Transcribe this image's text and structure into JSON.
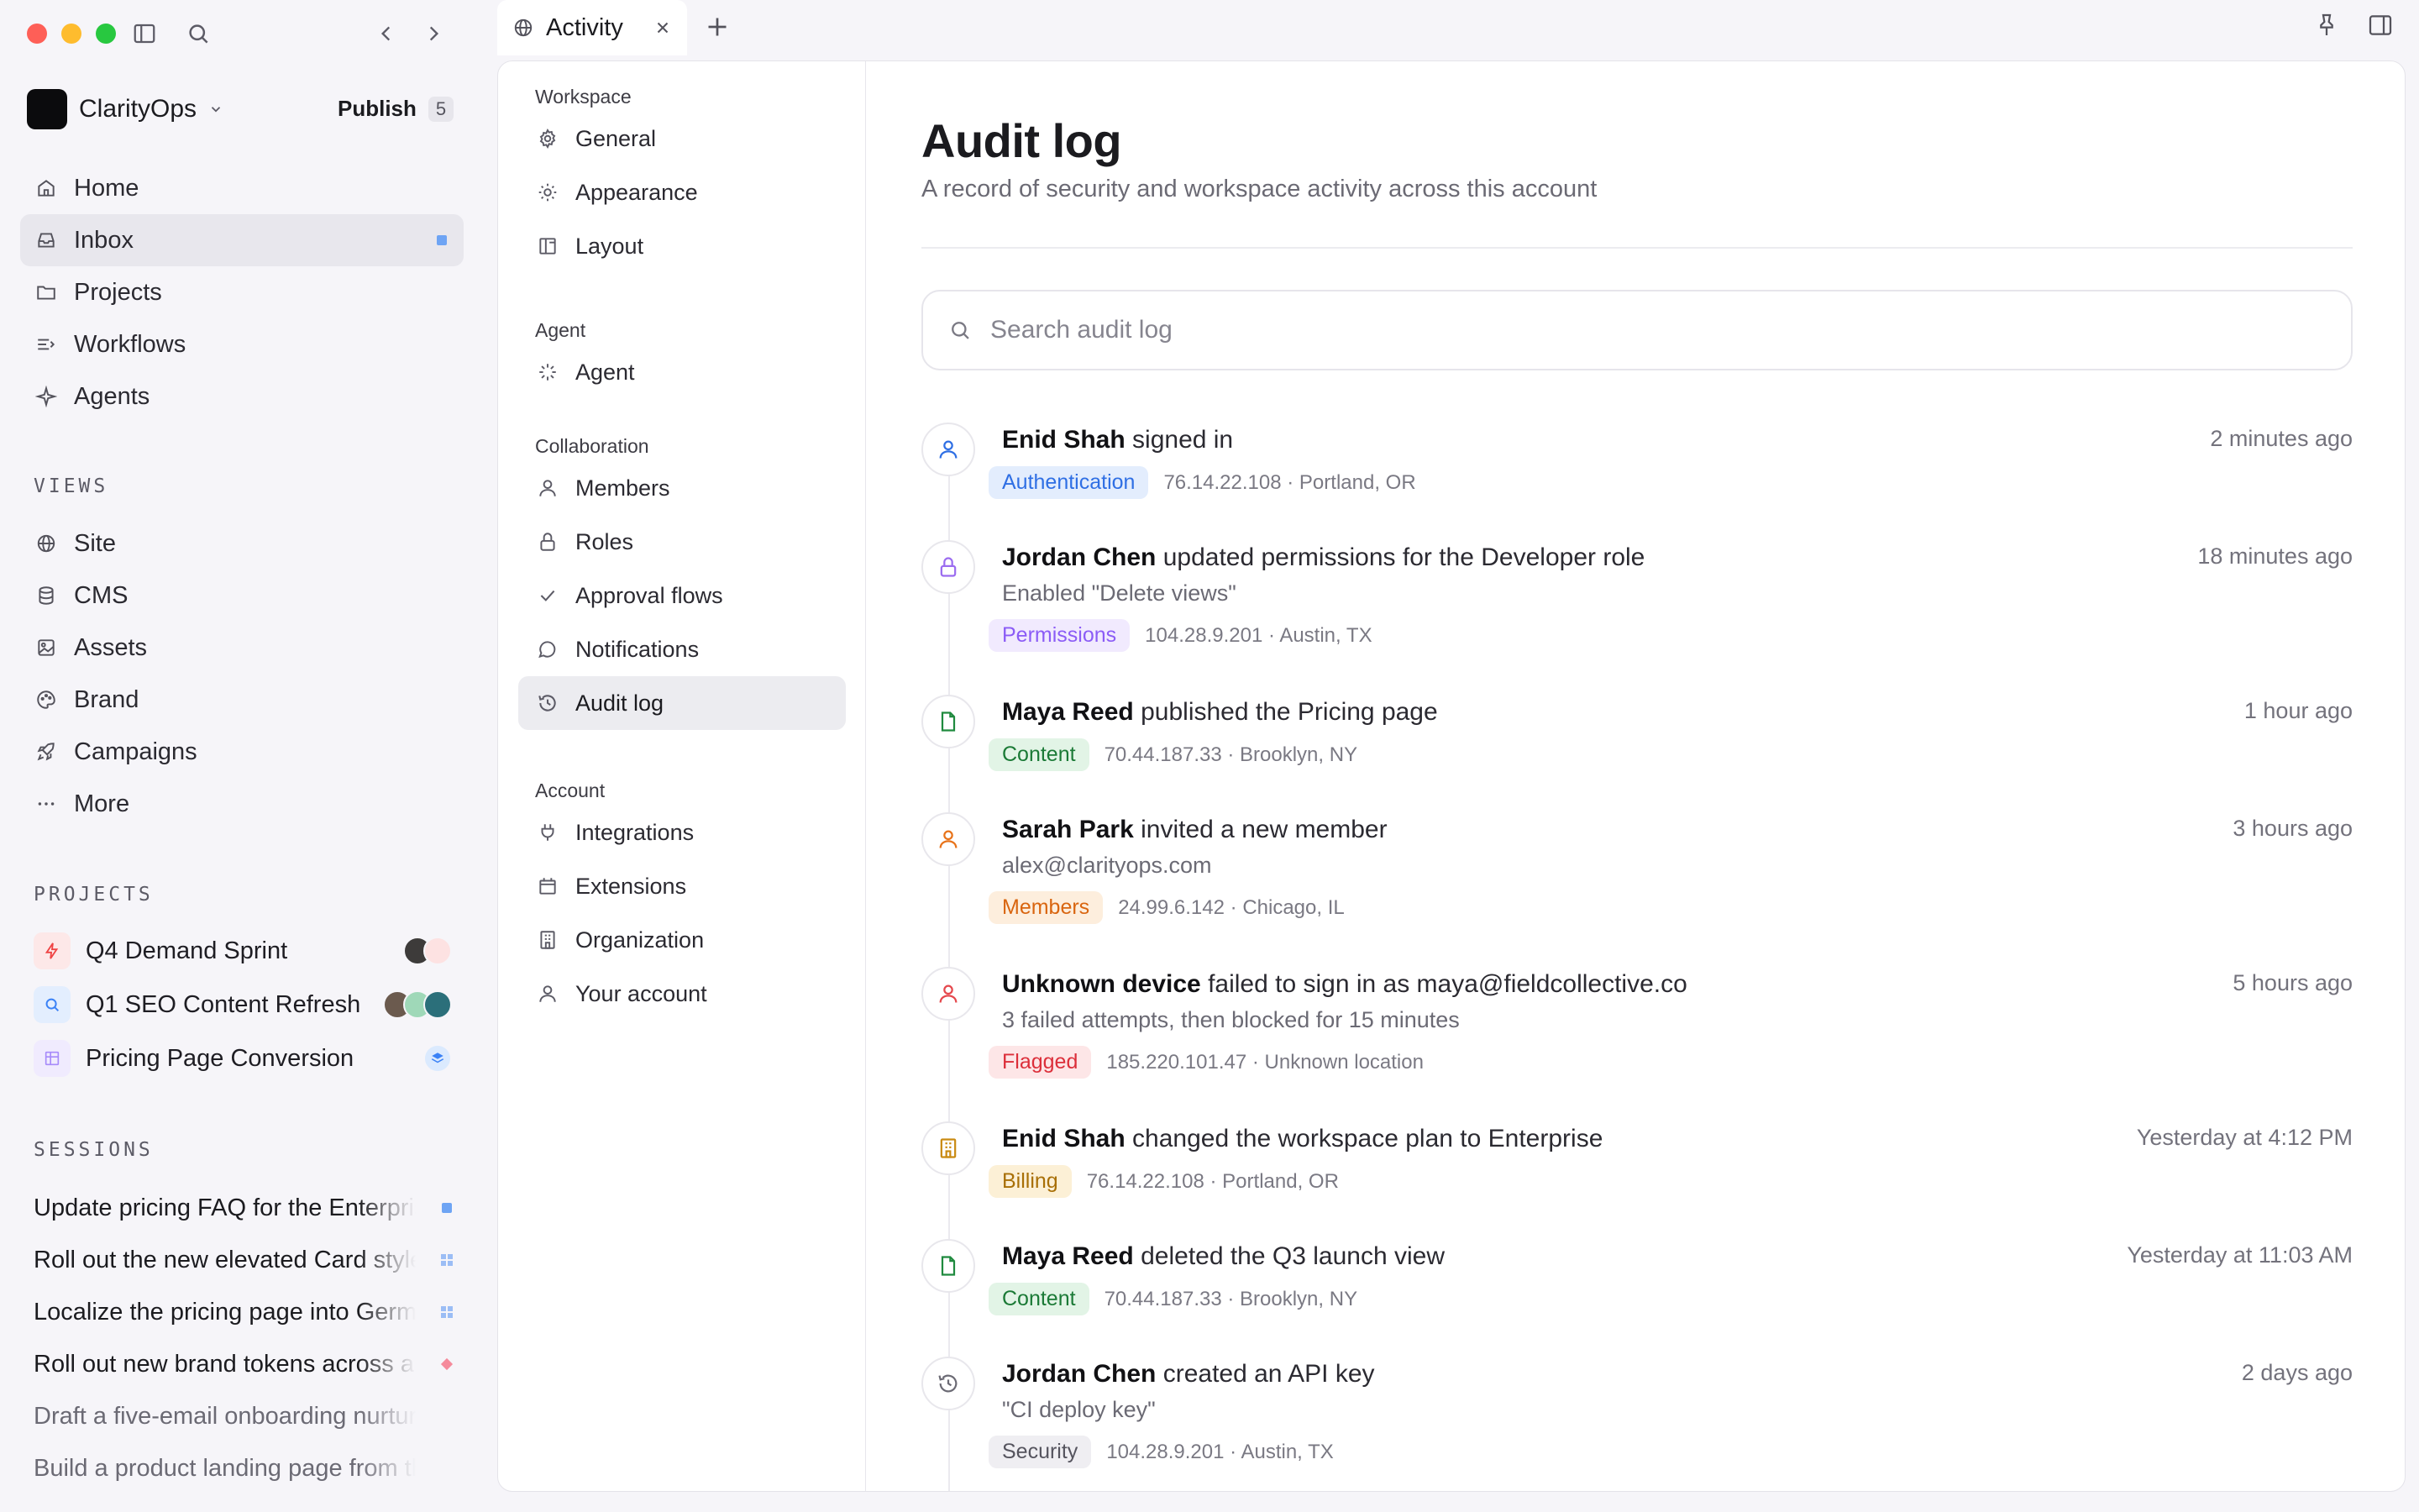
{
  "window": {
    "tab": {
      "label": "Activity"
    }
  },
  "sidebar": {
    "workspace": {
      "name": "ClarityOps",
      "publish_label": "Publish",
      "publish_count": "5"
    },
    "primary": [
      {
        "label": "Home",
        "icon": "home-icon"
      },
      {
        "label": "Inbox",
        "icon": "inbox-icon",
        "active": true
      },
      {
        "label": "Projects",
        "icon": "folder-icon"
      },
      {
        "label": "Workflows",
        "icon": "workflows-icon"
      },
      {
        "label": "Agents",
        "icon": "sparkle-icon"
      }
    ],
    "views_label": "VIEWS",
    "views": [
      {
        "label": "Site",
        "icon": "globe-icon"
      },
      {
        "label": "CMS",
        "icon": "database-icon"
      },
      {
        "label": "Assets",
        "icon": "image-icon"
      },
      {
        "label": "Brand",
        "icon": "palette-icon"
      },
      {
        "label": "Campaigns",
        "icon": "rocket-icon"
      },
      {
        "label": "More",
        "icon": "more-icon"
      }
    ],
    "projects_label": "PROJECTS",
    "projects": [
      {
        "label": "Q4 Demand Sprint",
        "icon": "bolt-icon",
        "color": "#ef4444",
        "bg": "#fde8e8"
      },
      {
        "label": "Q1 SEO Content Refresh",
        "icon": "search-icon",
        "color": "#3b82f6",
        "bg": "#e3eefe"
      },
      {
        "label": "Pricing Page Conversion",
        "icon": "grid-icon",
        "color": "#a78bfa",
        "bg": "#f0ebfe"
      }
    ],
    "sessions_label": "SESSIONS",
    "sessions": [
      {
        "label": "Update pricing FAQ for the Enterprise tier",
        "mark": "blue-square"
      },
      {
        "label": "Roll out the new elevated Card style",
        "mark": "blue-grid"
      },
      {
        "label": "Localize the pricing page into German",
        "mark": "blue-grid"
      },
      {
        "label": "Roll out new brand tokens across all pages",
        "mark": "pink-diamond"
      },
      {
        "label": "Draft a five-email onboarding nurture sequence",
        "mark": "none",
        "muted": true
      },
      {
        "label": "Build a product landing page from the brief",
        "mark": "none",
        "muted": true
      }
    ]
  },
  "settings_nav": [
    {
      "title": "Workspace",
      "items": [
        {
          "label": "General",
          "icon": "gear-icon"
        },
        {
          "label": "Appearance",
          "icon": "sun-icon"
        },
        {
          "label": "Layout",
          "icon": "layout-icon"
        }
      ]
    },
    {
      "title": "Agent",
      "items": [
        {
          "label": "Agent",
          "icon": "loader-icon"
        }
      ]
    },
    {
      "title": "Collaboration",
      "items": [
        {
          "label": "Members",
          "icon": "user-icon"
        },
        {
          "label": "Roles",
          "icon": "lock-icon"
        },
        {
          "label": "Approval flows",
          "icon": "check-icon"
        },
        {
          "label": "Notifications",
          "icon": "chat-icon"
        },
        {
          "label": "Audit log",
          "icon": "history-icon",
          "active": true
        }
      ]
    },
    {
      "title": "Account",
      "items": [
        {
          "label": "Integrations",
          "icon": "plug-icon"
        },
        {
          "label": "Extensions",
          "icon": "calendar-icon"
        },
        {
          "label": "Organization",
          "icon": "building-icon"
        },
        {
          "label": "Your account",
          "icon": "user-icon"
        }
      ]
    }
  ],
  "main": {
    "title": "Audit log",
    "subtitle": "A record of security and workspace activity across this account",
    "search_placeholder": "Search audit log",
    "entries": [
      {
        "actor": "Enid Shah",
        "action": "signed in",
        "detail": "",
        "category": "Authentication",
        "ip": "76.14.22.108",
        "location": "Portland, OR",
        "time": "2 minutes ago",
        "icon": "user-icon",
        "color": "#2f6fe4",
        "badge_bg": "#e3edfd",
        "badge_fg": "#2f6fe4"
      },
      {
        "actor": "Jordan Chen",
        "action": "updated permissions for the Developer role",
        "detail": "Enabled \"Delete views\"",
        "category": "Permissions",
        "ip": "104.28.9.201",
        "location": "Austin, TX",
        "time": "18 minutes ago",
        "icon": "lock-icon",
        "color": "#9b6cf0",
        "badge_bg": "#f1eafe",
        "badge_fg": "#8b5cf6"
      },
      {
        "actor": "Maya Reed",
        "action": "published the Pricing page",
        "detail": "",
        "category": "Content",
        "ip": "70.44.187.33",
        "location": "Brooklyn, NY",
        "time": "1 hour ago",
        "icon": "file-icon",
        "color": "#1f8a3e",
        "badge_bg": "#e2f4e6",
        "badge_fg": "#1b7a36"
      },
      {
        "actor": "Sarah Park",
        "action": "invited a new member",
        "detail": "alex@clarityops.com",
        "category": "Members",
        "ip": "24.99.6.142",
        "location": "Chicago, IL",
        "time": "3 hours ago",
        "icon": "user-icon",
        "color": "#e8731a",
        "badge_bg": "#fdeedd",
        "badge_fg": "#d9650f"
      },
      {
        "actor": "Unknown device",
        "action": "failed to sign in as maya@fieldcollective.co",
        "detail": "3 failed attempts, then blocked for 15 minutes",
        "category": "Flagged",
        "ip": "185.220.101.47",
        "location": "Unknown location",
        "time": "5 hours ago",
        "icon": "user-icon",
        "color": "#e5484d",
        "badge_bg": "#fde6e7",
        "badge_fg": "#dc2f3a"
      },
      {
        "actor": "Enid Shah",
        "action": "changed the workspace plan to Enterprise",
        "detail": "",
        "category": "Billing",
        "ip": "76.14.22.108",
        "location": "Portland, OR",
        "time": "Yesterday at 4:12 PM",
        "icon": "building-icon",
        "color": "#c98a12",
        "badge_bg": "#fcf0d6",
        "badge_fg": "#a86f06"
      },
      {
        "actor": "Maya Reed",
        "action": "deleted the Q3 launch view",
        "detail": "",
        "category": "Content",
        "ip": "70.44.187.33",
        "location": "Brooklyn, NY",
        "time": "Yesterday at 11:03 AM",
        "icon": "file-icon",
        "color": "#1f8a3e",
        "badge_bg": "#e2f4e6",
        "badge_fg": "#1b7a36"
      },
      {
        "actor": "Jordan Chen",
        "action": "created an API key",
        "detail": "\"CI deploy key\"",
        "category": "Security",
        "ip": "104.28.9.201",
        "location": "Austin, TX",
        "time": "2 days ago",
        "icon": "history-icon",
        "color": "#6b6a74",
        "badge_bg": "#efeef2",
        "badge_fg": "#55545e"
      }
    ]
  }
}
